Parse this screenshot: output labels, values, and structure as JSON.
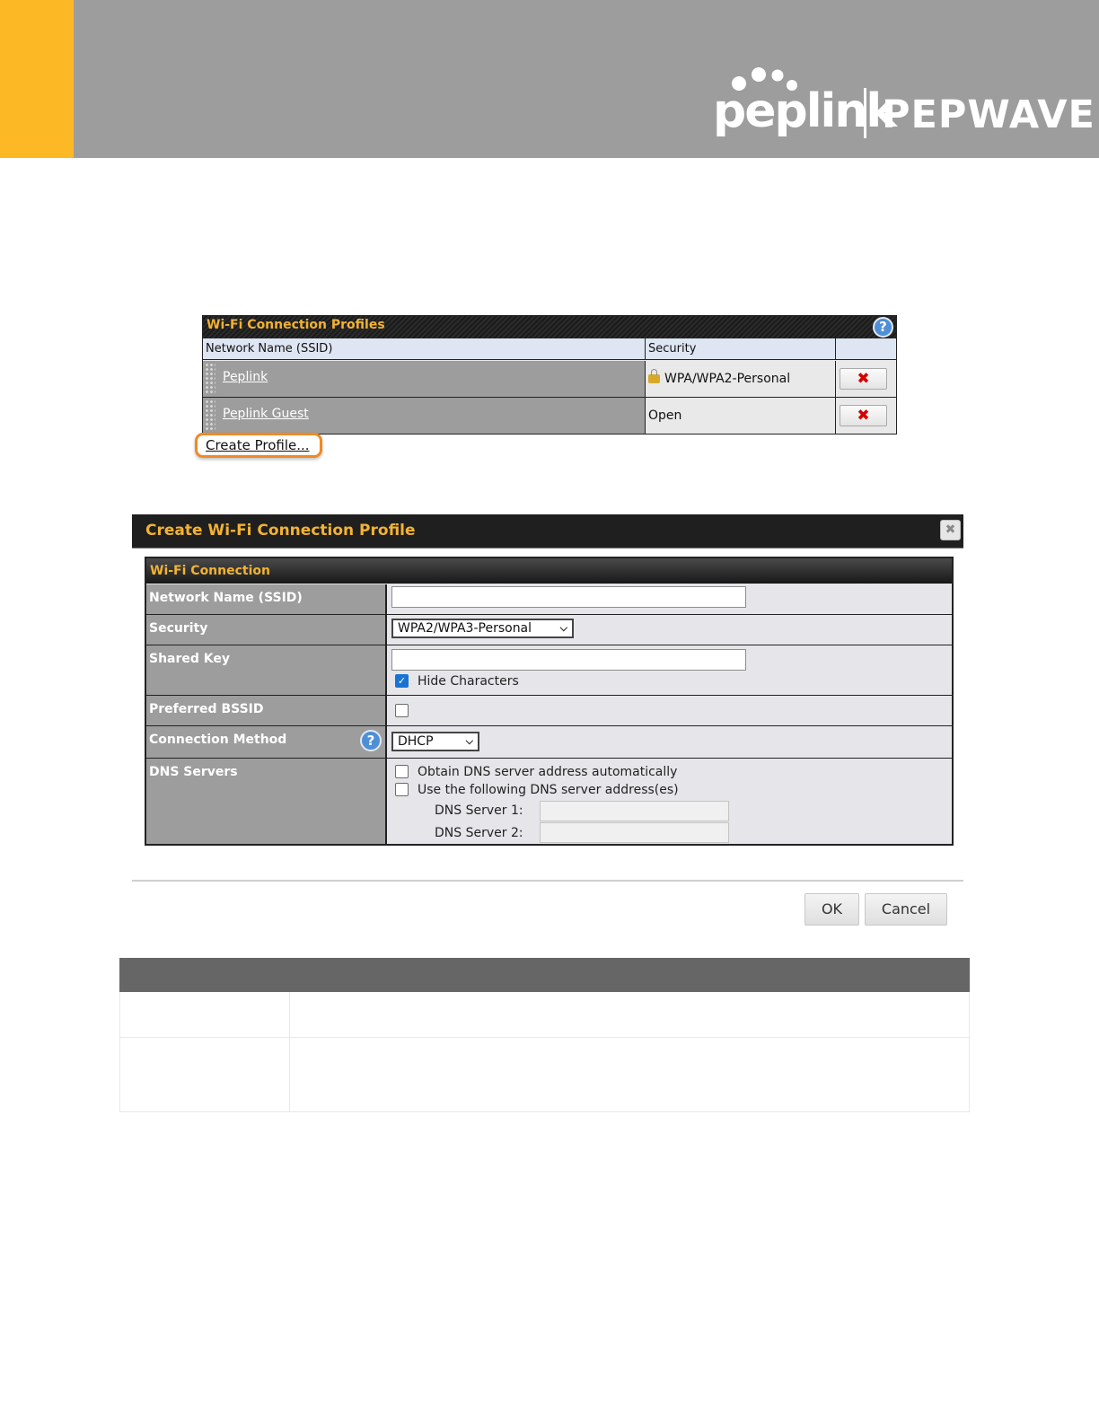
{
  "brand": {
    "logo_left": "peplink",
    "logo_right": "PEPWAVE",
    "accent_color": "#fdb825",
    "header_color": "#9d9d9d"
  },
  "profiles_table": {
    "title": "Wi-Fi Connection Profiles",
    "help_icon": "?",
    "columns": [
      "Network Name (SSID)",
      "Security"
    ],
    "rows": [
      {
        "name": "Peplink",
        "security": "WPA/WPA2-Personal",
        "locked": true,
        "delete_icon": "✖"
      },
      {
        "name": "Peplink Guest",
        "security": "Open",
        "locked": false,
        "delete_icon": "✖"
      }
    ],
    "create_link": "Create Profile..."
  },
  "dialog": {
    "title": "Create Wi-Fi Connection Profile",
    "close_icon": "✖",
    "section_title": "Wi-Fi Connection",
    "fields": {
      "ssid": {
        "label": "Network Name (SSID)",
        "value": ""
      },
      "security": {
        "label": "Security",
        "value": "WPA2/WPA3-Personal"
      },
      "shared_key": {
        "label": "Shared Key",
        "value": "",
        "hide_label": "Hide Characters",
        "hide_checked": true
      },
      "bssid": {
        "label": "Preferred BSSID",
        "checked": false
      },
      "connection_method": {
        "label": "Connection Method",
        "value": "DHCP",
        "help_icon": "?"
      },
      "dns": {
        "label": "DNS Servers",
        "auto_label": "Obtain DNS server address automatically",
        "manual_label": "Use the following DNS server address(es)",
        "server1_label": "DNS Server 1:",
        "server2_label": "DNS Server 2:",
        "server1_value": "",
        "server2_value": ""
      }
    },
    "ok_label": "OK",
    "cancel_label": "Cancel"
  }
}
